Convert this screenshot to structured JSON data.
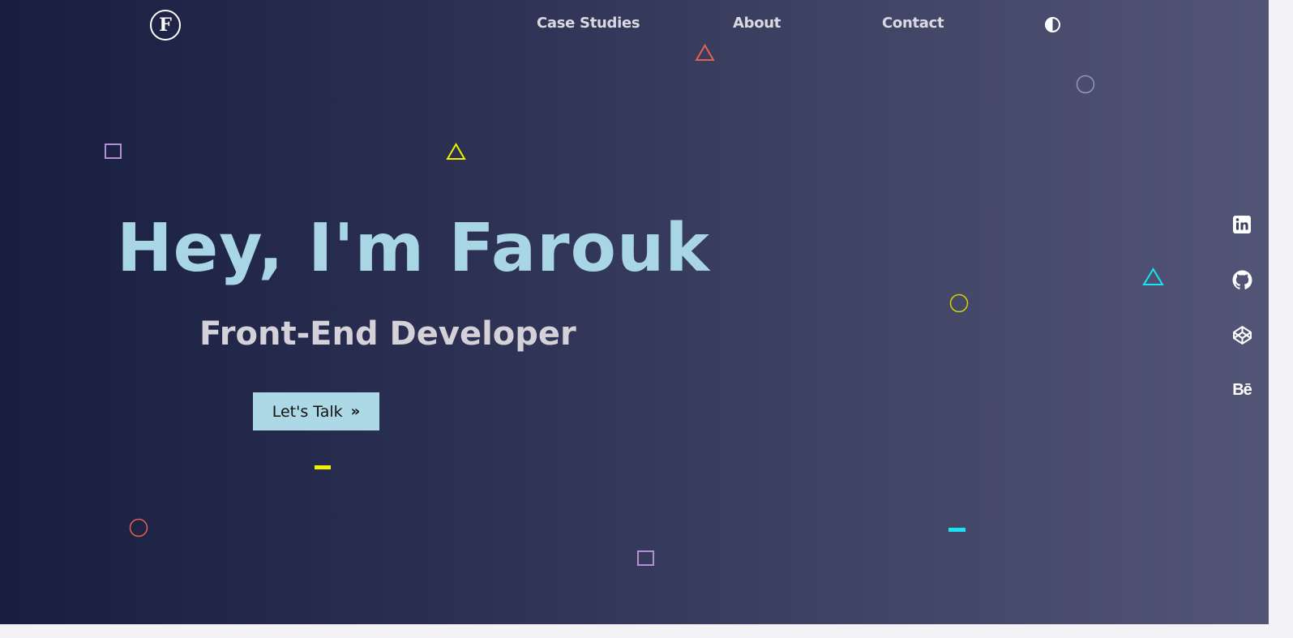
{
  "header": {
    "logo_letter": "F",
    "nav": [
      {
        "label": "Case Studies"
      },
      {
        "label": "About"
      },
      {
        "label": "Contact"
      }
    ],
    "theme_toggle_icon": "contrast-icon"
  },
  "hero": {
    "title": "Hey, I'm Farouk",
    "subtitle": "Front-End Developer",
    "cta_label": "Let's Talk",
    "cta_icon": "double-chevron-right-icon"
  },
  "social": [
    {
      "icon": "linkedin-icon"
    },
    {
      "icon": "github-icon"
    },
    {
      "icon": "codepen-icon"
    },
    {
      "icon": "behance-icon",
      "text": "Bē"
    }
  ],
  "colors": {
    "background_start": "#181e40",
    "background_end": "#525576",
    "title": "#a9d6e5",
    "subtitle": "#d4d2d8",
    "button_bg": "#add8e6",
    "shape_orange": "#e0644d",
    "shape_yellow": "#f2f200",
    "shape_purple": "#b48fd6",
    "shape_cyan": "#19e4f0",
    "shape_grey": "#9a96b3"
  }
}
